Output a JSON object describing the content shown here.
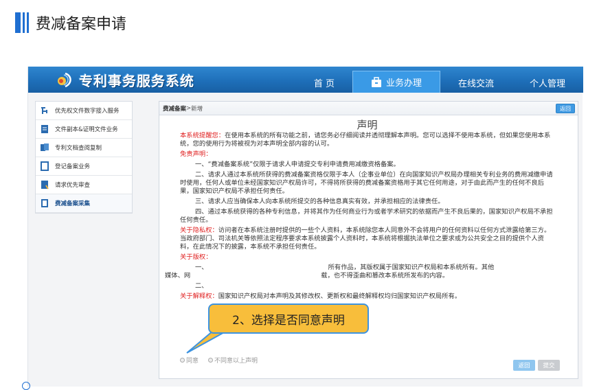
{
  "page": {
    "title": "费减备案申请"
  },
  "app": {
    "logo_text": "专利事务服务系统"
  },
  "nav": {
    "items": [
      {
        "label": "首 页",
        "active": false
      },
      {
        "label": "业务办理",
        "active": true
      },
      {
        "label": "在线交流",
        "active": false
      },
      {
        "label": "个人管理",
        "active": false
      }
    ]
  },
  "sidebar": {
    "items": [
      {
        "label": "优先权文件数字接入服务",
        "icon": "node-icon",
        "active": false
      },
      {
        "label": "文件副本&证明文件业务",
        "icon": "document-icon",
        "active": false
      },
      {
        "label": "专利文档查阅复制",
        "icon": "copy-document-icon",
        "active": false
      },
      {
        "label": "登记备案业务",
        "icon": "register-icon",
        "active": false
      },
      {
        "label": "请求优先审查",
        "icon": "priority-icon",
        "active": false
      },
      {
        "label": "费减备案采集",
        "icon": "fee-reduction-icon",
        "active": true
      }
    ]
  },
  "content": {
    "breadcrumb": {
      "section": "费减备案",
      "separator": " > ",
      "current": "新增"
    },
    "back_top": "返回",
    "doc": {
      "title": "声明",
      "reminder_label": "本系统提醒您：",
      "reminder_text": "在使用本系统的所有功能之前，请您务必仔细阅读并透彻理解本声明。您可以选择不使用本系统，但如果您使用本系统，您的使用行为将被视为对本声明全部内容的认可。",
      "disclaimer_label": "免责声明：",
      "clause1": "一、“费减备案系统”仅限于请求人申请提交专利申请费用减缴资格备案。",
      "clause2": "二、请求人通过本系统所获得的费减备案资格仅限于本人（企事业单位）在向国家知识产权局办理相关专利业务的费用减缴申请时使用，任何人或单位未经国家知识产权局许可，不得将所获得的费减备案资格用于其它任何用途，对于由此而产生的任何不良后果，国家知识产权局不承担任何责任。",
      "clause3": "三、请求人应当确保本人向本系统所提交的各种信息真实有效，并承担相应的法律责任。",
      "clause4": "四、通过本系统获得的各种专利信息，并将其作为任何商业行为或者学术研究的依据而产生不良后果的，国家知识产权局不承担任何责任。",
      "privacy_label": "关于隐私权：",
      "privacy_text": "访问者在本系统注册时提供的一些个人资料，本系统除您本人同意外不会将用户的任何资料以任何方式泄露给第三方。当政府部门、司法机关等依照法定程序要求本系统披露个人资料时，本系统将根据执法单位之要求或为公共安全之目的提供个人资料，在此情况下的披露，本系统不承担任何责任。",
      "copyright_label": "关于版权：",
      "copyright1_a": "一、",
      "copyright1_b": "所有作品，其版权属于国家知识产权局和本系统所有。其他",
      "copyright1_c": "媒体、网",
      "copyright1_d": "载，也不得歪曲和篡改本系统所发布的内容。",
      "copyright2": "二、",
      "interpret_label": "关于解释权：",
      "interpret_text": "国家知识产权局对本声明及其修改权、更新权和最终解释权均归国家知识产权局所有。"
    },
    "radio_agree": "同意",
    "radio_disagree": "不同意以上声明",
    "btn_back": "返回",
    "btn_submit": "提交"
  },
  "callout": {
    "text": "2、选择是否同意声明"
  },
  "colors": {
    "accent": "#1f6fd1",
    "callout_bg": "#f8be3b",
    "warning_red": "#e02020"
  }
}
